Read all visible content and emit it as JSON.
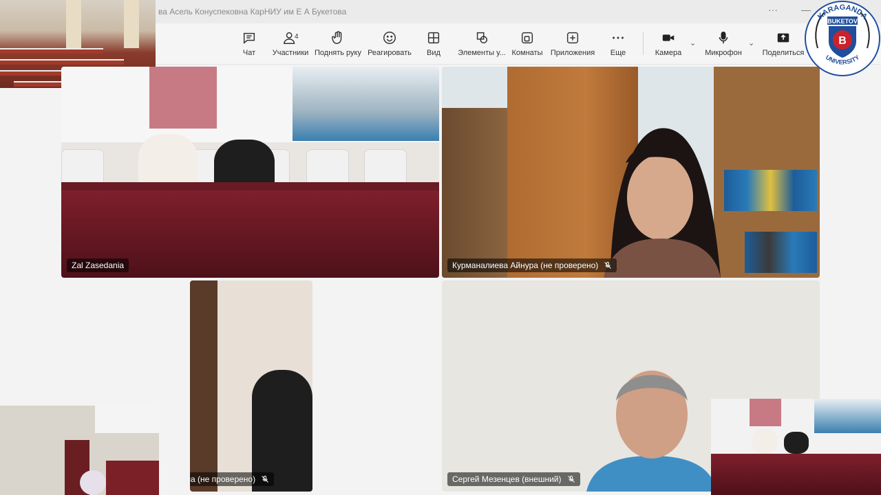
{
  "window": {
    "title": "ва Асель Конуспековна КарНИУ им Е А Букетова",
    "more_glyph": "···",
    "minimize_glyph": "—"
  },
  "toolbar": {
    "chat": {
      "label": "Чат",
      "icon": "chat-icon"
    },
    "participants": {
      "label": "Участники",
      "count": "4",
      "icon": "people-icon"
    },
    "raise_hand": {
      "label": "Поднять руку",
      "icon": "hand-icon"
    },
    "react": {
      "label": "Реагировать",
      "icon": "smile-icon"
    },
    "view": {
      "label": "Вид",
      "icon": "grid-icon"
    },
    "elements": {
      "label": "Элементы у...",
      "icon": "shapes-icon"
    },
    "rooms": {
      "label": "Комнаты",
      "icon": "rooms-icon"
    },
    "apps": {
      "label": "Приложения",
      "icon": "plus-square-icon"
    },
    "more": {
      "label": "Еще",
      "icon": "ellipsis-icon"
    },
    "camera": {
      "label": "Камера",
      "icon": "camera-icon"
    },
    "mic": {
      "label": "Микрофон",
      "icon": "microphone-icon"
    },
    "share": {
      "label": "Поделиться",
      "icon": "share-icon"
    }
  },
  "tiles": [
    {
      "name": "Zal Zasedania",
      "muted": false
    },
    {
      "name": "Курманалиева Айнура (не проверено)",
      "muted": true
    },
    {
      "name": "Львовна (не проверено)",
      "muted": true
    },
    {
      "name": "Сергей Мезенцев (внешний)",
      "muted": true
    }
  ],
  "logo": {
    "top_text": "KARAGANDA",
    "middle_text": "BUKETOV",
    "bottom_text": "UNIVERSITY",
    "letter": "B"
  },
  "colors": {
    "accent_blue": "#1f4e9c",
    "desk_red": "#7e1f2c"
  }
}
